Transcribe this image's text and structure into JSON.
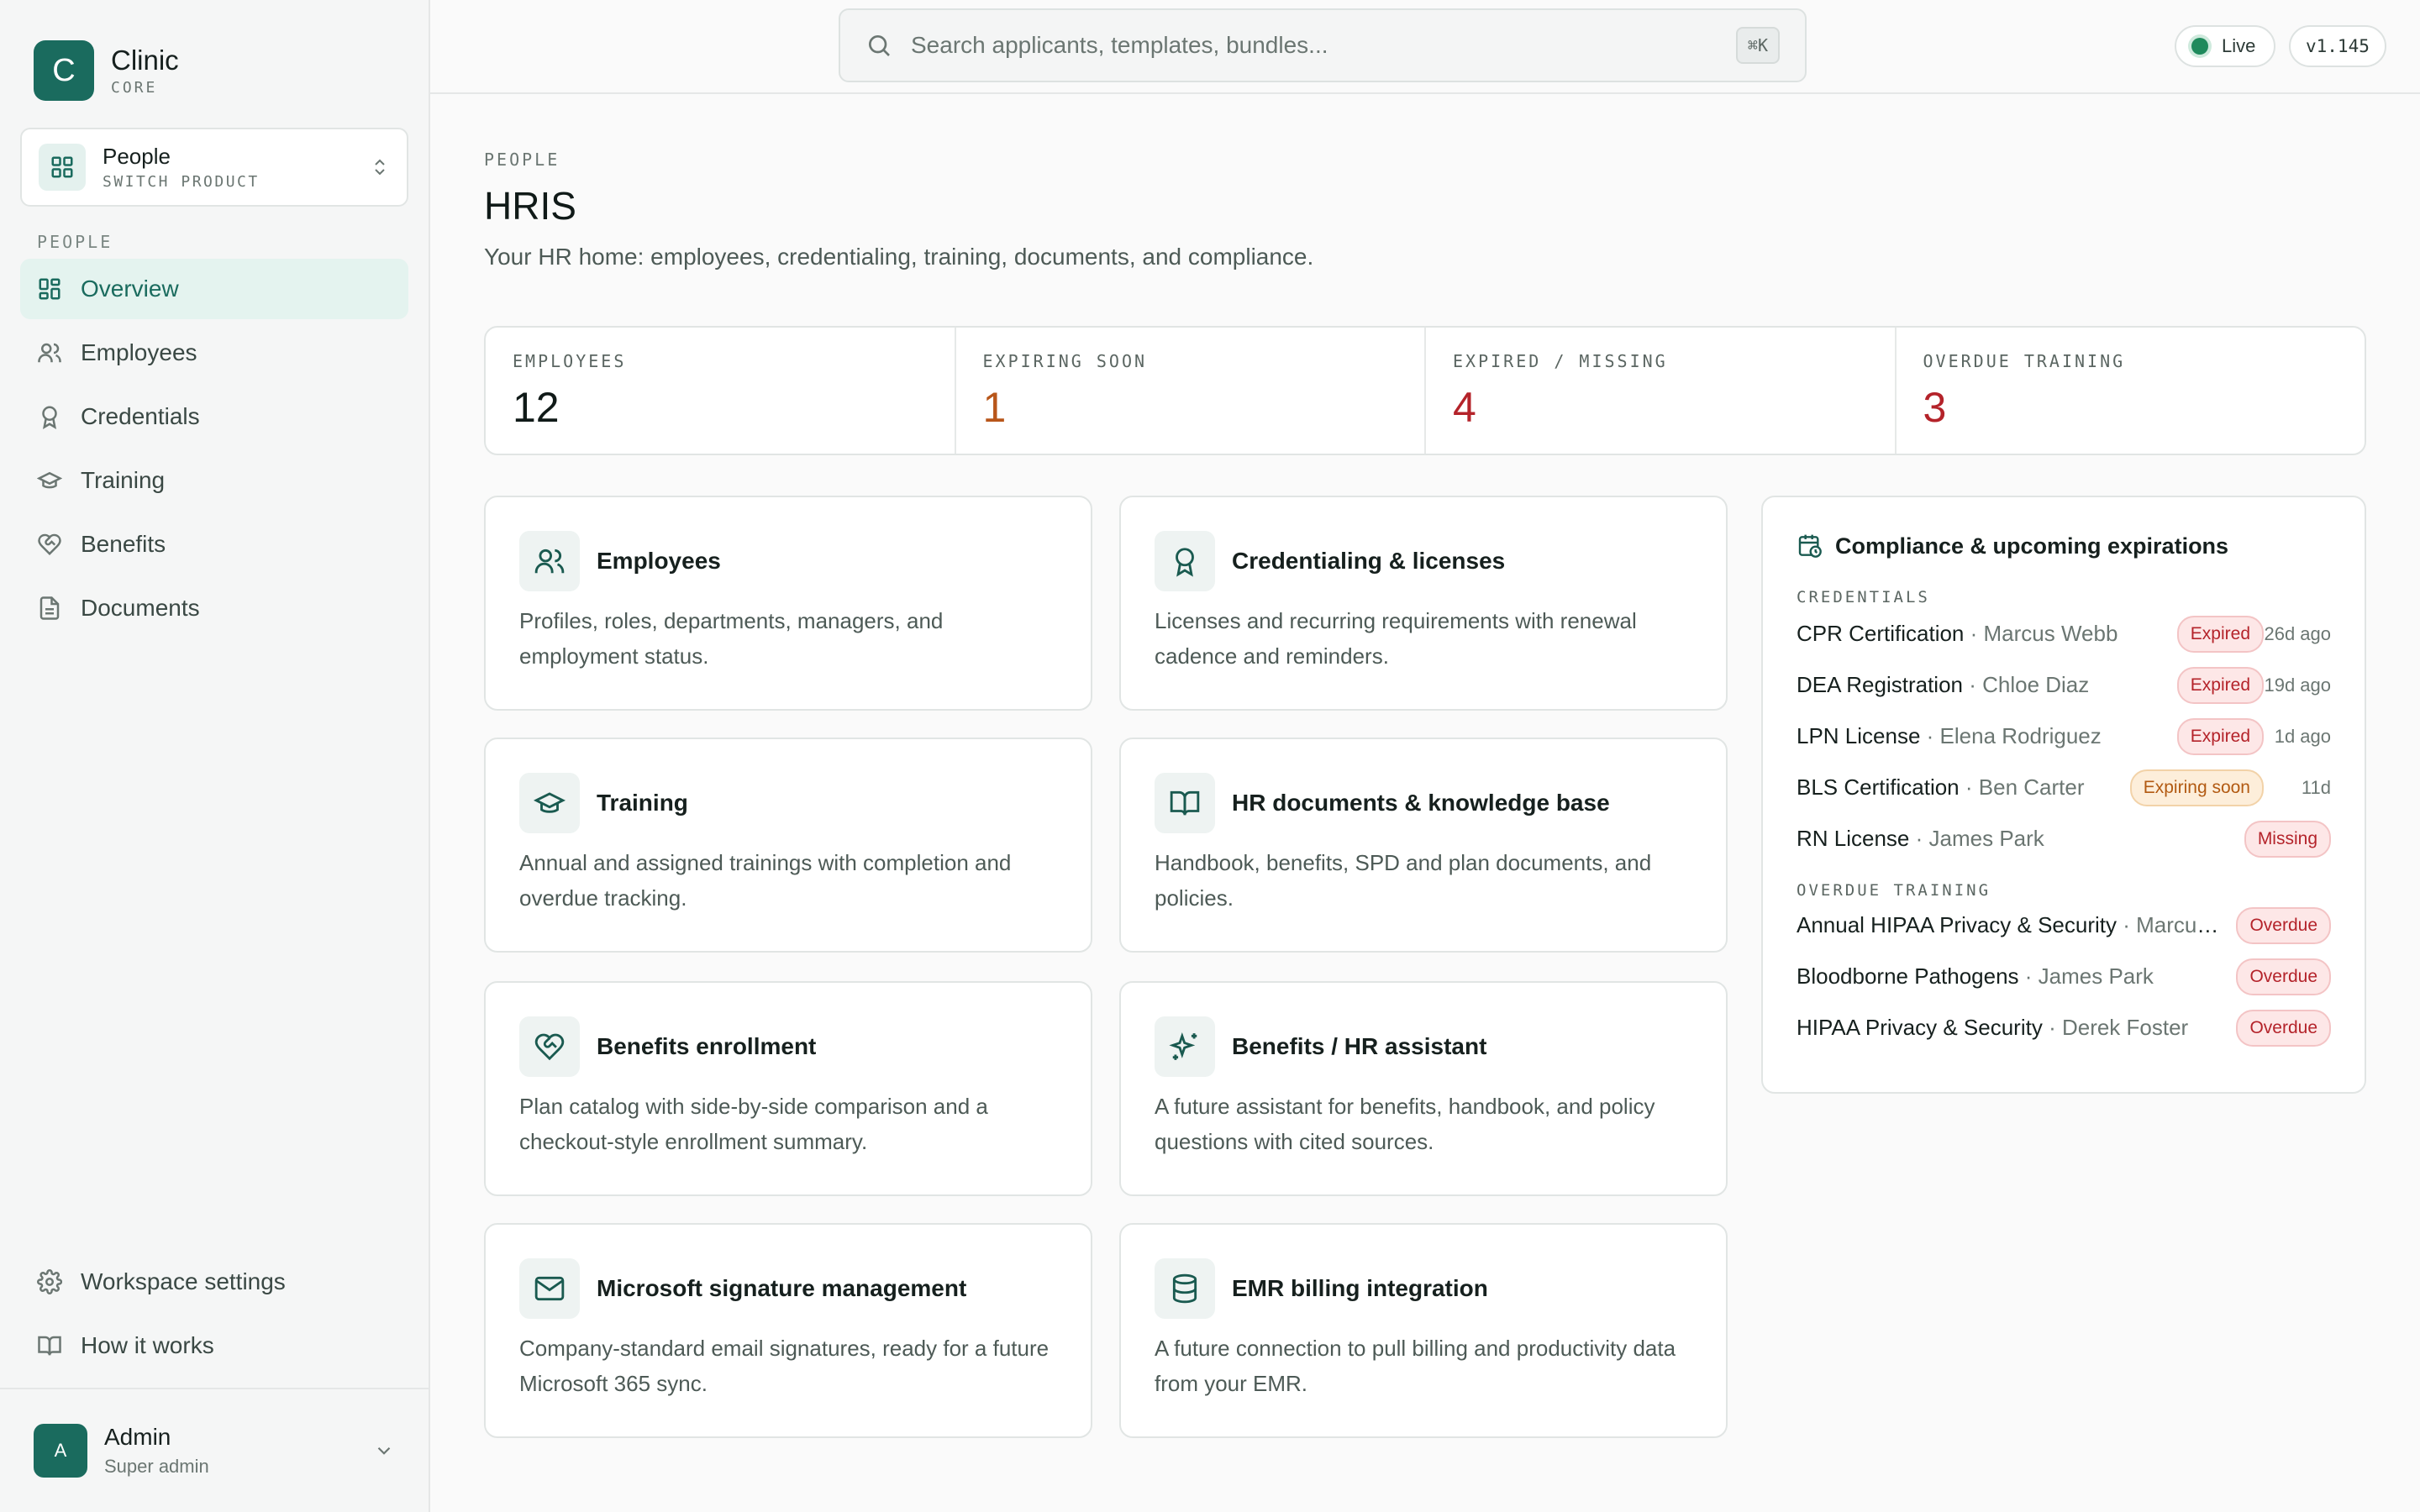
{
  "brand": {
    "logo_letter": "C",
    "name": "Clinic",
    "sub": "CORE"
  },
  "switcher": {
    "name": "People",
    "sub": "SWITCH PRODUCT"
  },
  "sidebar": {
    "section_label": "PEOPLE",
    "items": [
      {
        "label": "Overview",
        "icon": "grid-icon",
        "active": true
      },
      {
        "label": "Employees",
        "icon": "users-icon"
      },
      {
        "label": "Credentials",
        "icon": "award-icon"
      },
      {
        "label": "Training",
        "icon": "graduation-cap-icon"
      },
      {
        "label": "Benefits",
        "icon": "heart-handshake-icon"
      },
      {
        "label": "Documents",
        "icon": "file-icon"
      }
    ],
    "bottom_items": [
      {
        "label": "Workspace settings",
        "icon": "gear-icon"
      },
      {
        "label": "How it works",
        "icon": "book-icon"
      }
    ]
  },
  "user": {
    "initial": "A",
    "name": "Admin",
    "role": "Super admin"
  },
  "topbar": {
    "search_placeholder": "Search applicants, templates, bundles...",
    "shortcut": "⌘K",
    "status": "Live",
    "version": "v1.145"
  },
  "page": {
    "eyebrow": "PEOPLE",
    "title": "HRIS",
    "description": "Your HR home: employees, credentialing, training, documents, and compliance."
  },
  "stats": [
    {
      "label": "EMPLOYEES",
      "value": "12",
      "color": "#101a18"
    },
    {
      "label": "EXPIRING SOON",
      "value": "1",
      "color": "#b8561a"
    },
    {
      "label": "EXPIRED / MISSING",
      "value": "4",
      "color": "#b4232a"
    },
    {
      "label": "OVERDUE TRAINING",
      "value": "3",
      "color": "#b4232a"
    }
  ],
  "cards": [
    {
      "title": "Employees",
      "desc": "Profiles, roles, departments, managers, and employment status.",
      "icon": "users-icon"
    },
    {
      "title": "Credentialing & licenses",
      "desc": "Licenses and recurring requirements with renewal cadence and reminders.",
      "icon": "award-icon"
    },
    {
      "title": "Training",
      "desc": "Annual and assigned trainings with completion and overdue tracking.",
      "icon": "graduation-cap-icon"
    },
    {
      "title": "HR documents & knowledge base",
      "desc": "Handbook, benefits, SPD and plan documents, and policies.",
      "icon": "book-open-icon"
    },
    {
      "title": "Benefits enrollment",
      "desc": "Plan catalog with side-by-side comparison and a checkout-style enrollment summary.",
      "icon": "heart-handshake-icon"
    },
    {
      "title": "Benefits / HR assistant",
      "desc": "A future assistant for benefits, handbook, and policy questions with cited sources.",
      "icon": "sparkles-icon"
    },
    {
      "title": "Microsoft signature management",
      "desc": "Company-standard email signatures, ready for a future Microsoft 365 sync.",
      "icon": "mail-icon"
    },
    {
      "title": "EMR billing integration",
      "desc": "A future connection to pull billing and productivity data from your EMR.",
      "icon": "database-icon"
    }
  ],
  "compliance": {
    "title": "Compliance & upcoming expirations",
    "credentials_label": "CREDENTIALS",
    "credentials": [
      {
        "name": "CPR Certification",
        "person": "Marcus Webb",
        "status": "Expired",
        "when": "26d ago"
      },
      {
        "name": "DEA Registration",
        "person": "Chloe Diaz",
        "status": "Expired",
        "when": "19d ago"
      },
      {
        "name": "LPN License",
        "person": "Elena Rodriguez",
        "status": "Expired",
        "when": "1d ago"
      },
      {
        "name": "BLS Certification",
        "person": "Ben Carter",
        "status": "Expiring soon",
        "when": "11d"
      },
      {
        "name": "RN License",
        "person": "James Park",
        "status": "Missing",
        "when": ""
      }
    ],
    "training_label": "OVERDUE TRAINING",
    "training": [
      {
        "name": "Annual HIPAA Privacy & Security",
        "person": "Marcus Webb",
        "status": "Overdue"
      },
      {
        "name": "Bloodborne Pathogens",
        "person": "James Park",
        "status": "Overdue"
      },
      {
        "name": "HIPAA Privacy & Security",
        "person": "Derek Foster",
        "status": "Overdue"
      }
    ]
  }
}
